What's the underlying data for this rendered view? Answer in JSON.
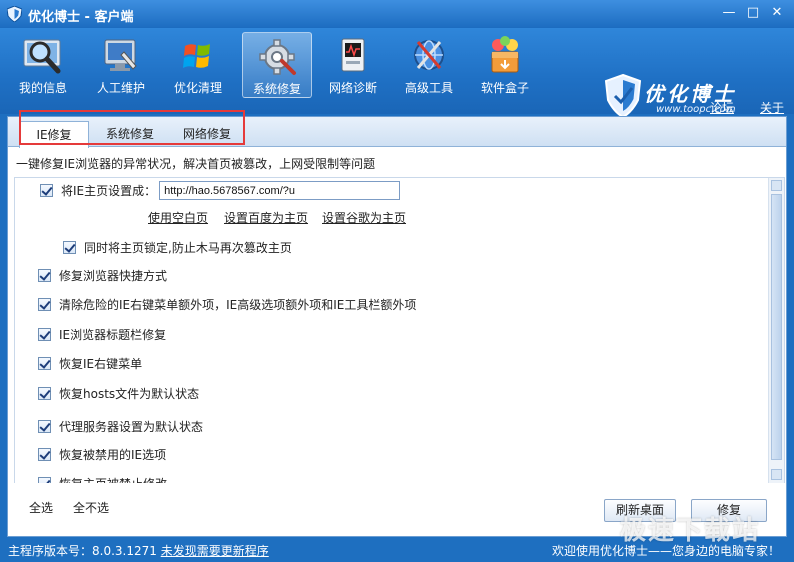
{
  "window": {
    "title": "优化博士 - 客户端",
    "controls": [
      "minimize-icon",
      "maximize-icon",
      "close-icon"
    ]
  },
  "toolbar": {
    "items": [
      {
        "label": "我的信息",
        "icon": "magnifier-icon"
      },
      {
        "label": "人工维护",
        "icon": "monitor-wrench-icon"
      },
      {
        "label": "优化清理",
        "icon": "windows-logo-icon"
      },
      {
        "label": "系统修复",
        "icon": "gear-icon",
        "active": true
      },
      {
        "label": "网络诊断",
        "icon": "network-monitor-icon"
      },
      {
        "label": "高级工具",
        "icon": "globe-tools-icon"
      },
      {
        "label": "软件盒子",
        "icon": "software-box-icon"
      }
    ]
  },
  "brand": {
    "name": "优化博士",
    "url": "www.toopc.com"
  },
  "top_links": [
    "论坛",
    "关于"
  ],
  "tabs": [
    {
      "label": "IE修复",
      "active": true
    },
    {
      "label": "系统修复"
    },
    {
      "label": "网络修复"
    }
  ],
  "description": "一键修复IE浏览器的异常状况，解决首页被篡改，上网受限制等问题",
  "homepage": {
    "label": "将IE主页设置成：",
    "value": "http://hao.5678567.com/?u",
    "links": [
      "使用空白页",
      "设置百度为主页",
      "设置谷歌为主页"
    ],
    "lock_label": "同时将主页锁定,防止木马再次篡改主页"
  },
  "options": [
    "修复浏览器快捷方式",
    "清除危险的IE右键菜单额外项，IE高级选项额外项和IE工具栏额外项",
    "IE浏览器标题栏修复",
    "恢复IE右键菜单",
    "恢复hosts文件为默认状态",
    "代理服务器设置为默认状态",
    "恢复被禁用的IE选项",
    "恢复主页被禁止修改"
  ],
  "footer": {
    "select_all": "全选",
    "select_none": "全不选",
    "refresh_button": "刷新桌面",
    "repair_button": "修复"
  },
  "status": {
    "version_label": "主程序版本号：8.0.3.1271",
    "update_link": "未发现需要更新程序",
    "welcome": "欢迎使用优化博士——您身边的电脑专家！"
  },
  "watermark": "极速下载站",
  "colors": {
    "frame_blue": "#1e6fc0",
    "highlight_red": "#e53a3a"
  }
}
